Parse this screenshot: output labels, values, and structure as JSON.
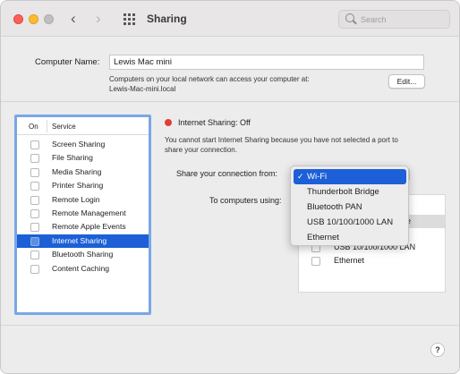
{
  "window": {
    "title": "Sharing"
  },
  "toolbar": {
    "back_glyph": "‹",
    "forward_glyph": "›",
    "search_placeholder": "Search"
  },
  "computer_name": {
    "label": "Computer Name:",
    "value": "Lewis Mac mini",
    "description_line1": "Computers on your local network can access your computer at:",
    "description_line2": "Lewis-Mac-mini.local",
    "edit_label": "Edit..."
  },
  "services": {
    "header_on": "On",
    "header_service": "Service",
    "items": [
      {
        "label": "Screen Sharing",
        "on": false,
        "selected": false
      },
      {
        "label": "File Sharing",
        "on": false,
        "selected": false
      },
      {
        "label": "Media Sharing",
        "on": false,
        "selected": false
      },
      {
        "label": "Printer Sharing",
        "on": false,
        "selected": false
      },
      {
        "label": "Remote Login",
        "on": false,
        "selected": false
      },
      {
        "label": "Remote Management",
        "on": false,
        "selected": false
      },
      {
        "label": "Remote Apple Events",
        "on": false,
        "selected": false
      },
      {
        "label": "Internet Sharing",
        "on": false,
        "selected": true
      },
      {
        "label": "Bluetooth Sharing",
        "on": false,
        "selected": false
      },
      {
        "label": "Content Caching",
        "on": false,
        "selected": false
      }
    ]
  },
  "internet_sharing": {
    "status": "Internet Sharing: Off",
    "status_color": "#e33d3a",
    "warning_line1": "You cannot start Internet Sharing because you have not selected a port to",
    "warning_line2": "share your connection.",
    "share_from_label": "Share your connection from:",
    "to_computers_label": "To computers using:",
    "ports_partial": {
      "selected_row_trailing": "e",
      "row_usb": "USB 10/100/1000 LAN",
      "row_ethernet": "Ethernet"
    }
  },
  "dropdown": {
    "selected": "Wi-Fi",
    "check_glyph": "✓",
    "options": [
      "Wi-Fi",
      "Thunderbolt Bridge",
      "Bluetooth PAN",
      "USB 10/100/1000 LAN",
      "Ethernet"
    ]
  },
  "help": {
    "label": "?"
  },
  "colors": {
    "accent": "#1d5fd7",
    "selection": "#1c5fd6",
    "focus_ring": "#7aa7e6"
  }
}
